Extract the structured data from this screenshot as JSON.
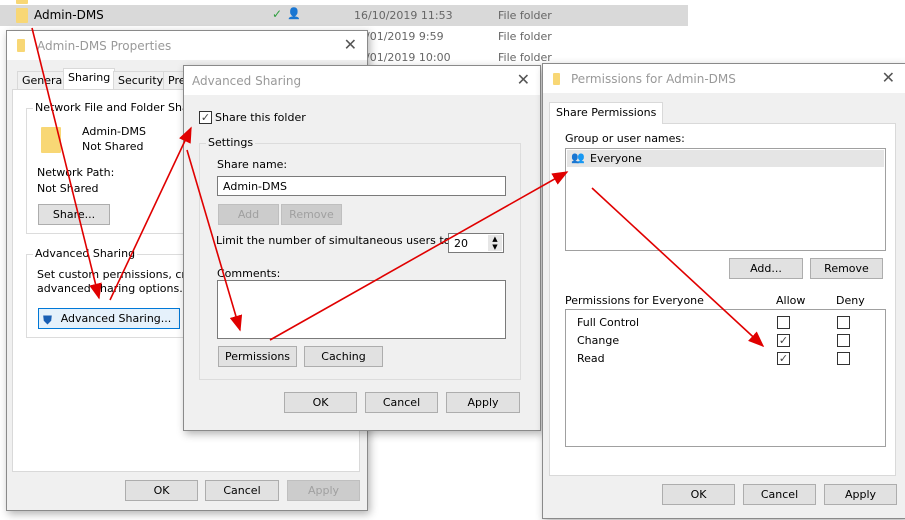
{
  "explorer": {
    "rows": [
      {
        "name": "Admin-DMS",
        "date": "16/10/2019 11:53",
        "type": "File folder",
        "status": "synced"
      },
      {
        "name": "",
        "date": "/01/2019 9:59",
        "type": "File folder"
      },
      {
        "name": "",
        "date": "/01/2019 10:00",
        "type": "File folder"
      }
    ]
  },
  "properties": {
    "title": "Admin-DMS Properties",
    "tabs": [
      "General",
      "Sharing",
      "Security",
      "Pre"
    ],
    "active_tab": "Sharing",
    "nfs_group": "Network File and Folder Sharing",
    "folder_name": "Admin-DMS",
    "folder_status": "Not Shared",
    "path_label": "Network Path:",
    "path_value": "Not Shared",
    "share_button": "Share...",
    "adv_group": "Advanced Sharing",
    "adv_text1": "Set custom permissions, create",
    "adv_text2": "advanced sharing options.",
    "adv_button": "Advanced Sharing...",
    "ok": "OK",
    "cancel": "Cancel",
    "apply": "Apply"
  },
  "advanced": {
    "title": "Advanced Sharing",
    "share_checkbox": "Share this folder",
    "share_checked": true,
    "settings": "Settings",
    "share_name_label": "Share name:",
    "share_name": "Admin-DMS",
    "add": "Add",
    "remove": "Remove",
    "limit_label": "Limit the number of simultaneous users to:",
    "limit_value": "20",
    "comments_label": "Comments:",
    "comments": "",
    "permissions": "Permissions",
    "caching": "Caching",
    "ok": "OK",
    "cancel": "Cancel",
    "apply": "Apply"
  },
  "permissions": {
    "title": "Permissions for Admin-DMS",
    "tab": "Share Permissions",
    "group_label": "Group or user names:",
    "users": [
      "Everyone"
    ],
    "add": "Add...",
    "remove": "Remove",
    "perm_label": "Permissions for Everyone",
    "allow": "Allow",
    "deny": "Deny",
    "rows": [
      {
        "name": "Full Control",
        "allow": false,
        "deny": false
      },
      {
        "name": "Change",
        "allow": true,
        "deny": false
      },
      {
        "name": "Read",
        "allow": true,
        "deny": false
      }
    ],
    "ok": "OK",
    "cancel": "Cancel",
    "apply": "Apply"
  },
  "colors": {
    "arrow": "#e00000",
    "selection": "#d9d9d9",
    "focus": "#0078d7"
  }
}
